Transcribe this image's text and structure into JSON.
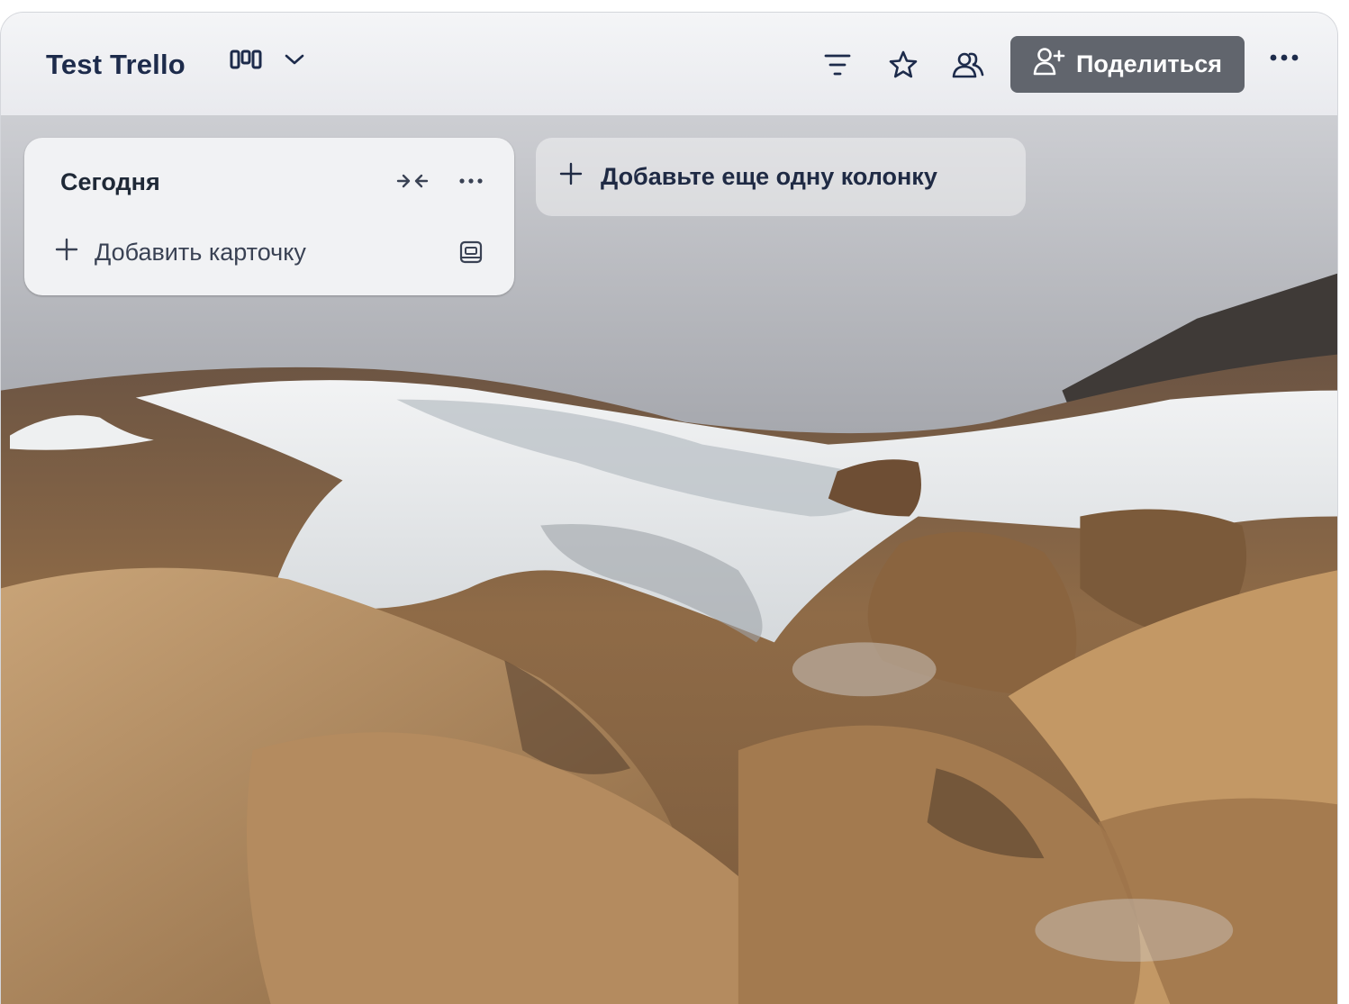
{
  "board": {
    "title": "Test Trello"
  },
  "header": {
    "view_icon": "board-view-icon",
    "chevron_icon": "chevron-down-icon",
    "filter_icon": "filter-icon",
    "star_icon": "star-icon",
    "members_icon": "members-icon",
    "share_label": "Поделиться",
    "share_icon": "add-person-icon",
    "more_icon": "more-horizontal-icon"
  },
  "column": {
    "title": "Сегодня",
    "collapse_icon": "collapse-icon",
    "more_icon": "more-horizontal-icon",
    "add_card_label": "Добавить карточку",
    "template_icon": "card-template-icon"
  },
  "add_column": {
    "label": "Добавьте еще одну колонку"
  },
  "colors": {
    "header_bg": "#eceef1",
    "title_text": "#1d2b4b",
    "share_bg": "#61656d",
    "column_bg": "#f1f2f4"
  }
}
